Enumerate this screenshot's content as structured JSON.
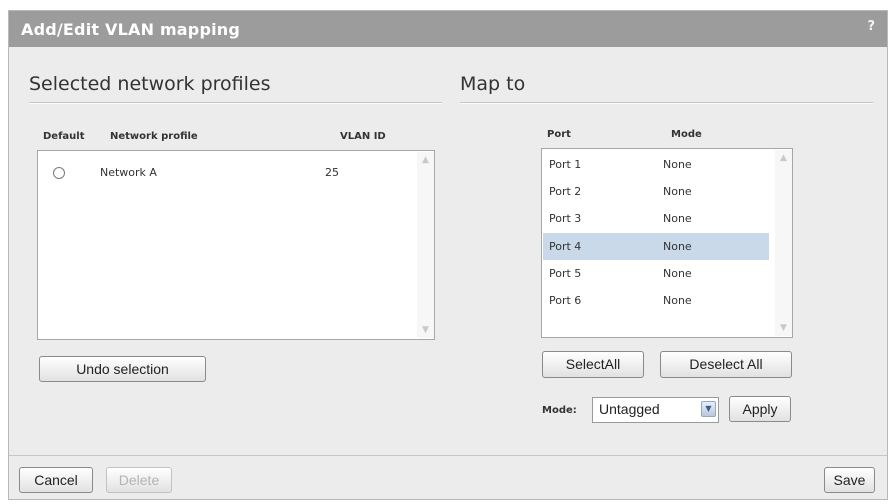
{
  "dialog": {
    "title": "Add/Edit VLAN mapping",
    "help_label": "?"
  },
  "left": {
    "heading": "Selected network profiles",
    "columns": {
      "default": "Default",
      "profile": "Network profile",
      "vlan": "VLAN ID"
    },
    "rows": [
      {
        "profile": "Network A",
        "vlan": "25",
        "default_selected": false
      }
    ],
    "undo_label": "Undo selection"
  },
  "right": {
    "heading": "Map to",
    "columns": {
      "port": "Port",
      "mode": "Mode"
    },
    "ports": [
      {
        "port": "Port 1",
        "mode": "None"
      },
      {
        "port": "Port 2",
        "mode": "None"
      },
      {
        "port": "Port 3",
        "mode": "None"
      },
      {
        "port": "Port 4",
        "mode": "None",
        "selected": true
      },
      {
        "port": "Port 5",
        "mode": "None"
      },
      {
        "port": "Port 6",
        "mode": "None"
      }
    ],
    "select_all_label": "SelectAll",
    "deselect_all_label": "Deselect All",
    "mode_label": "Mode:",
    "mode_value": "Untagged",
    "apply_label": "Apply"
  },
  "footer": {
    "cancel_label": "Cancel",
    "delete_label": "Delete",
    "save_label": "Save"
  },
  "icons": {
    "help": "help-icon",
    "scroll_up": "chevron-up-icon",
    "scroll_down": "chevron-down-icon",
    "dropdown": "chevron-down-icon"
  },
  "colors": {
    "titlebar": "#9c9c9c",
    "dialog_bg": "#ececec",
    "selected_row": "#c9d9ea"
  }
}
